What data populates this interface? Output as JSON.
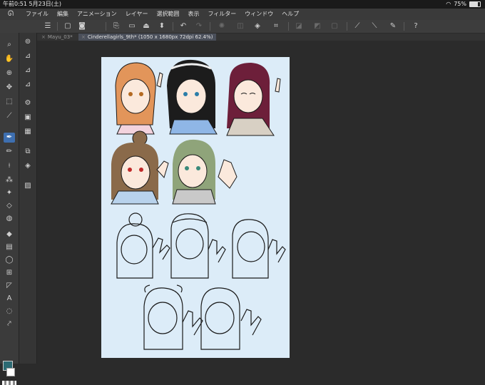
{
  "status_bar": {
    "time": "午前0:51",
    "date": "5月23日(土)",
    "wifi_icon": "wifi-icon",
    "battery_percent": "75%",
    "battery_level": 0.75
  },
  "menu": {
    "items": [
      "ファイル",
      "編集",
      "アニメーション",
      "レイヤー",
      "選択範囲",
      "表示",
      "フィルター",
      "ウィンドウ",
      "ヘルプ"
    ]
  },
  "tabs": [
    {
      "label": "Mayu_03*",
      "active": false
    },
    {
      "label": "Cinderellagirls_9th* (1050 x 1680px 72dpi 62.4%)",
      "active": true
    }
  ],
  "colors": {
    "main_color": "#2c6a73",
    "sub_color": "#ffffff",
    "accent_selected": "#3e6fb0"
  },
  "toolbar_icons": [
    "menu-icon",
    "new-icon",
    "open-icon",
    "save-icon",
    "undo-icon",
    "redo-icon",
    "loading-icon",
    "transform-icon",
    "fill-icon",
    "crop-icon",
    "ruler-icon",
    "snap-icon",
    "pen-icon",
    "brush-icon",
    "eraser-icon",
    "help-icon"
  ],
  "tool_icons": [
    "search-icon",
    "hand-icon",
    "zoom-icon",
    "move-icon",
    "select-icon",
    "eyedropper-icon",
    "pen-icon",
    "pencil-icon",
    "brush-icon",
    "airbrush-icon",
    "decoration-icon",
    "eraser-icon",
    "blend-icon",
    "fill-icon",
    "gradient-icon",
    "shape-icon",
    "frame-icon",
    "ruler-icon",
    "text-icon",
    "balloon-icon",
    "correct-line-icon"
  ]
}
